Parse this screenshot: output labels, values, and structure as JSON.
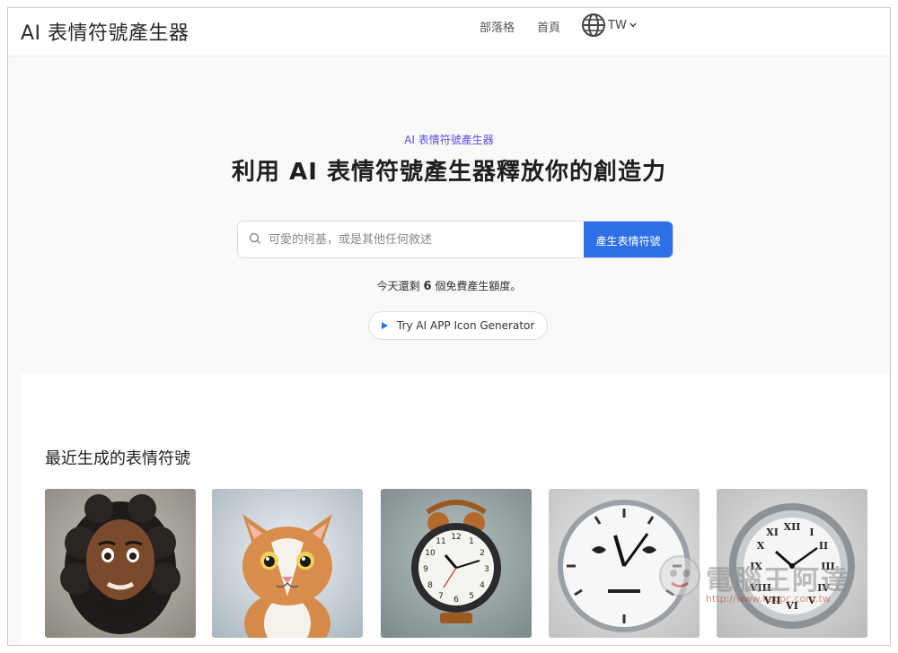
{
  "header": {
    "logo": "AI 表情符號產生器",
    "nav_blog": "部落格",
    "nav_home": "首頁",
    "lang": "TW"
  },
  "hero": {
    "subtitle": "AI 表情符號產生器",
    "title": "利用 AI 表情符號產生器釋放你的創造力",
    "search_placeholder": "可愛的柯基，或是其他任何敘述",
    "generate_button": "產生表情符號",
    "quota_prefix": "今天還剩",
    "quota_count": "6",
    "quota_suffix": "個免費產生額度。",
    "pill_label": "Try AI APP Icon Generator"
  },
  "recent": {
    "title": "最近生成的表情符號",
    "items": [
      {
        "icon": "bearded-man-emoji"
      },
      {
        "icon": "tabby-cat-emoji"
      },
      {
        "icon": "alarm-clock-emoji"
      },
      {
        "icon": "clock-face-emoji"
      },
      {
        "icon": "roman-clock-emoji"
      }
    ]
  },
  "watermark": {
    "text": "電腦王阿達",
    "url": "http://www.kocpc.com.tw"
  },
  "colors": {
    "accent": "#2f6fe6",
    "subtitle": "#5a4fe0",
    "background": "#f9f9fa"
  }
}
